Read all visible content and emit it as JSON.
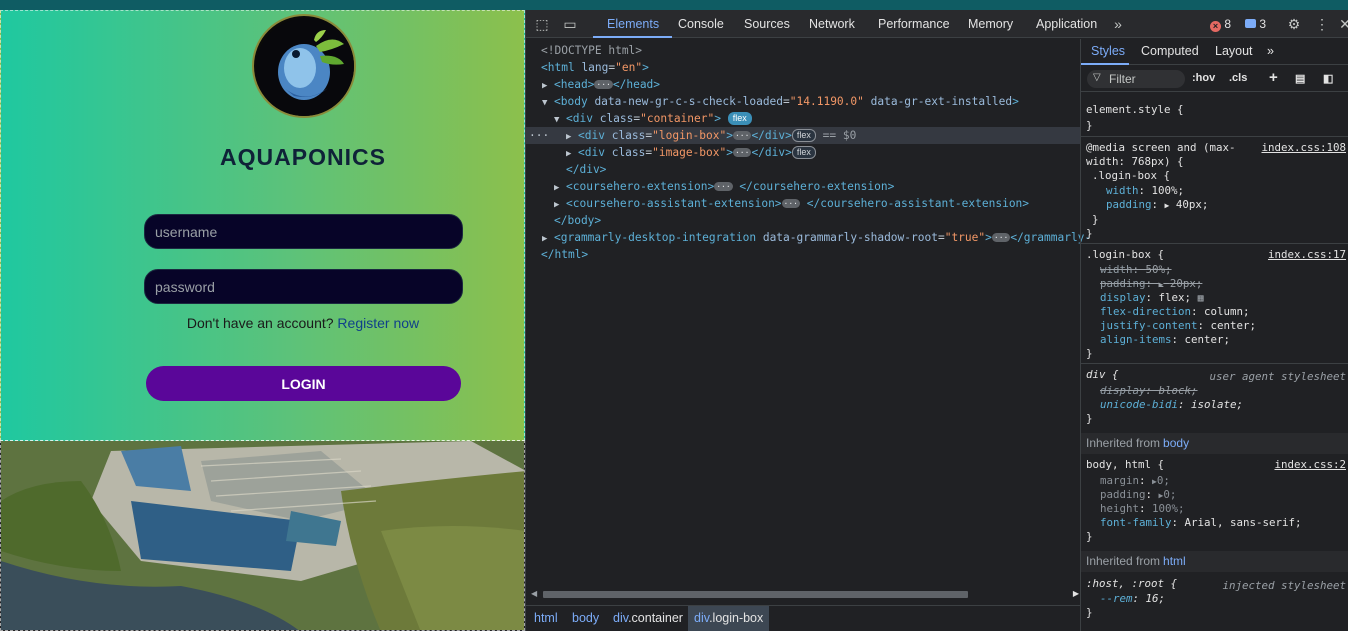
{
  "page": {
    "title": "AQUAPONICS",
    "username_placeholder": "username",
    "password_placeholder": "password",
    "register_prompt": "Don't have an account?",
    "register_link": "Register now",
    "login_label": "LOGIN"
  },
  "devtools": {
    "tabs": [
      "Elements",
      "Console",
      "Sources",
      "Network",
      "Performance",
      "Memory",
      "Application"
    ],
    "error_count": "8",
    "message_count": "3",
    "dom": {
      "doctype": "<!DOCTYPE html>",
      "html_open": "<html",
      "lang_attr": "lang",
      "lang_val": "\"en\"",
      "head_text": "<head>",
      "head_close": "</head>",
      "body_open": "<body",
      "body_attr1": "data-new-gr-c-s-check-loaded",
      "body_val1": "\"14.1190.0\"",
      "body_attr2": "data-gr-ext-installed",
      "div_open": "<div",
      "class_attr": "class",
      "container_val": "\"container\"",
      "login_val": "\"login-box\"",
      "image_val": "\"image-box\"",
      "div_close": "</div>",
      "flex_badge": "flex",
      "eq_dollar": "== $0",
      "ce_open": "<coursehero-extension>",
      "ce_close": "</coursehero-extension>",
      "cae_open": "<coursehero-assistant-extension>",
      "cae_close": "</coursehero-assistant-extension>",
      "body_close": "</body>",
      "gdi_open": "<grammarly-desktop-integration",
      "gdi_attr": "data-grammarly-shadow-root",
      "gdi_val": "\"true\"",
      "gdi_close": "</grammarly-",
      "html_close": "</html>"
    },
    "breadcrumbs": [
      {
        "tag": "html",
        "cls": ""
      },
      {
        "tag": "body",
        "cls": ""
      },
      {
        "tag": "div",
        "cls": ".container"
      },
      {
        "tag": "div",
        "cls": ".login-box"
      }
    ],
    "styles": {
      "tabs": [
        "Styles",
        "Computed",
        "Layout"
      ],
      "filter_placeholder": "Filter",
      "hov": ":hov",
      "cls": ".cls",
      "element_style": "element.style {",
      "media_line1": "@media screen and (max-",
      "media_line2": "width: 768px) {",
      "media_src": "index.css:108",
      "media_selector": ".login-box {",
      "media_width_prop": "width",
      "media_width_val": "100%;",
      "media_padding_prop": "padding",
      "media_padding_val": "40px;",
      "rule2_selector": ".login-box {",
      "rule2_src": "index.css:17",
      "r2_width_prop": "width",
      "r2_width_val": "50%;",
      "r2_padding_prop": "padding",
      "r2_padding_val": "20px;",
      "r2_display_prop": "display",
      "r2_display_val": "flex;",
      "r2_fd_prop": "flex-direction",
      "r2_fd_val": "column;",
      "r2_jc_prop": "justify-content",
      "r2_jc_val": "center;",
      "r2_ai_prop": "align-items",
      "r2_ai_val": "center;",
      "ua_selector": "div {",
      "ua_src": "user agent stylesheet",
      "ua_display_prop": "display",
      "ua_display_val": "block;",
      "ua_bidi_prop": "unicode-bidi",
      "ua_bidi_val": "isolate;",
      "inherited_label": "Inherited from",
      "inherited_body": "body",
      "inherited_html": "html",
      "body_selector": "body, html {",
      "body_src": "index.css:2",
      "b_margin_prop": "margin",
      "b_margin_val": "0;",
      "b_padding_prop": "padding",
      "b_padding_val": "0;",
      "b_height_prop": "height",
      "b_height_val": "100%;",
      "b_font_prop": "font-family",
      "b_font_val": "Arial, sans-serif;",
      "root_selector": ":host, :root {",
      "root_src": "injected stylesheet",
      "root_prop": "--rem",
      "root_val": "16;",
      "close_brace": "}"
    }
  }
}
